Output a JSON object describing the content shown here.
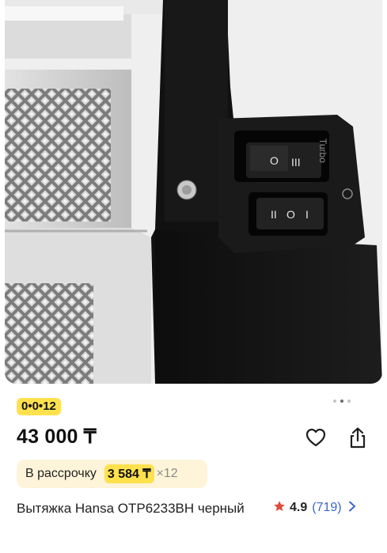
{
  "product": {
    "installment_badge": "0•0•12",
    "price": "43 000 ₸",
    "installment": {
      "label": "В рассрочку",
      "amount": "3 584 ₸",
      "months": "×12"
    },
    "title": "Вытяжка Hansa OTP6233BH черный",
    "rating": "4.9",
    "reviews": "(719)",
    "image": {
      "switch_label": "Turbo",
      "gallery_dots": 3,
      "active_dot": 1
    }
  },
  "icons": {
    "favorite": "heart-icon",
    "share": "share-icon",
    "star": "star-icon",
    "more": "chevron-right-icon"
  },
  "colors": {
    "badge": "#ffe14d",
    "installment_bg": "#fdf4d9",
    "star": "#e04b3a",
    "link": "#3a66c9"
  }
}
